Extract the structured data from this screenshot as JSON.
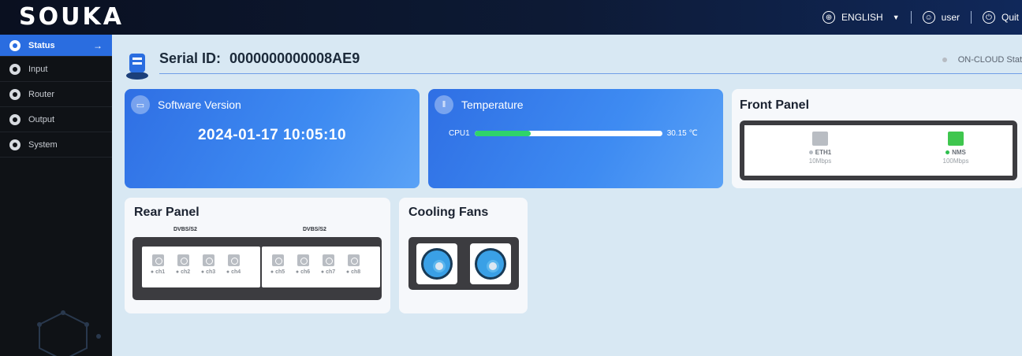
{
  "header": {
    "logo": "SOUKA",
    "language": "ENGLISH",
    "user": "user",
    "quit": "Quit"
  },
  "sidebar": {
    "items": [
      {
        "label": "Status",
        "active": true
      },
      {
        "label": "Input"
      },
      {
        "label": "Router"
      },
      {
        "label": "Output"
      },
      {
        "label": "System"
      }
    ]
  },
  "serial": {
    "label": "Serial ID:",
    "value": "0000000000008AE9",
    "cloud_status": "ON-CLOUD Stat"
  },
  "software": {
    "title": "Software Version",
    "date": "2024-01-17 10:05:10"
  },
  "temperature": {
    "title": "Temperature",
    "sensor": "CPU1",
    "value": "30.15 ℃",
    "level_fraction": 0.3
  },
  "front_panel": {
    "title": "Front Panel",
    "ports": [
      {
        "name": "ETH1",
        "speed": "10Mbps",
        "status_color": "#b7bcc3"
      },
      {
        "name": "NMS",
        "speed": "100Mbps",
        "status_color": "#2fbf4f"
      }
    ]
  },
  "rear_panel": {
    "title": "Rear Panel",
    "groups": [
      {
        "label": "DVBS/S2",
        "channels": [
          "ch1",
          "ch2",
          "ch3",
          "ch4"
        ]
      },
      {
        "label": "DVBS/S2",
        "channels": [
          "ch5",
          "ch6",
          "ch7",
          "ch8"
        ]
      }
    ]
  },
  "cooling": {
    "title": "Cooling Fans"
  },
  "colors": {
    "accent": "#2a6de0",
    "green": "#2fd36a",
    "panel_dark": "#3c3c40"
  }
}
